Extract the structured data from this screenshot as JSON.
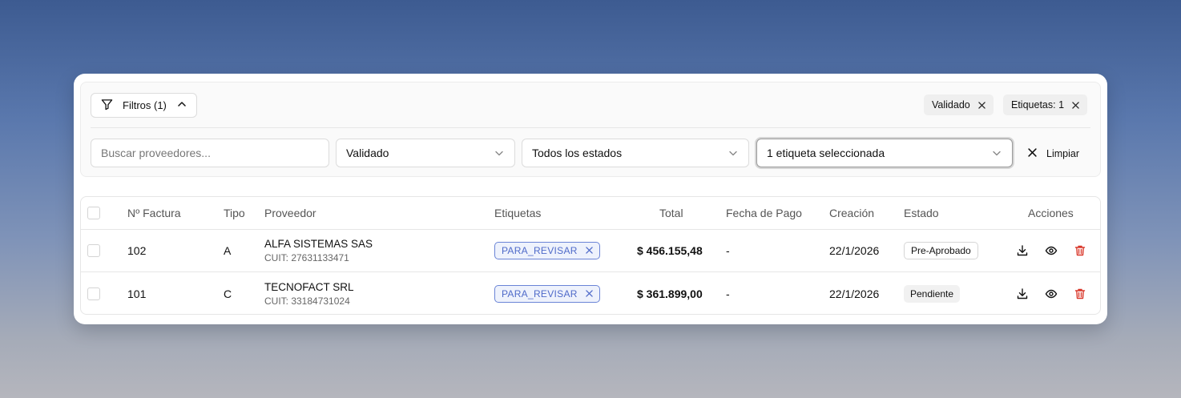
{
  "filters": {
    "button_label": "Filtros (1)",
    "active_chips": [
      {
        "label": "Validado"
      },
      {
        "label": "Etiquetas: 1"
      }
    ],
    "search_placeholder": "Buscar proveedores...",
    "search_value": "",
    "validation_select": "Validado",
    "status_select": "Todos los estados",
    "tags_select": "1 etiqueta seleccionada",
    "clear_label": "Limpiar"
  },
  "table": {
    "columns": {
      "invoice": "Nº Factura",
      "type": "Tipo",
      "provider": "Proveedor",
      "tags": "Etiquetas",
      "total": "Total",
      "payment_date": "Fecha de Pago",
      "created": "Creación",
      "status": "Estado",
      "actions": "Acciones"
    },
    "rows": [
      {
        "invoice": "102",
        "type": "A",
        "provider_name": "ALFA SISTEMAS SAS",
        "provider_cuit": "CUIT: 27631133471",
        "tag": "PARA_REVISAR",
        "total": "$ 456.155,48",
        "payment_date": "-",
        "created": "22/1/2026",
        "status": "Pre-Aprobado",
        "status_style": "outline"
      },
      {
        "invoice": "101",
        "type": "C",
        "provider_name": "TECNOFACT SRL",
        "provider_cuit": "CUIT: 33184731024",
        "tag": "PARA_REVISAR",
        "total": "$ 361.899,00",
        "payment_date": "-",
        "created": "22/1/2026",
        "status": "Pendiente",
        "status_style": "filled"
      }
    ]
  },
  "colors": {
    "tag_border": "#6a84d6",
    "tag_text": "#4f6ac9",
    "delete_icon": "#d9382b"
  },
  "icons": {
    "filter": "funnel-icon",
    "collapse": "chevron-up-icon",
    "remove": "close-icon",
    "select": "chevron-down-icon",
    "download": "download-icon",
    "view": "eye-icon",
    "delete": "trash-icon"
  }
}
